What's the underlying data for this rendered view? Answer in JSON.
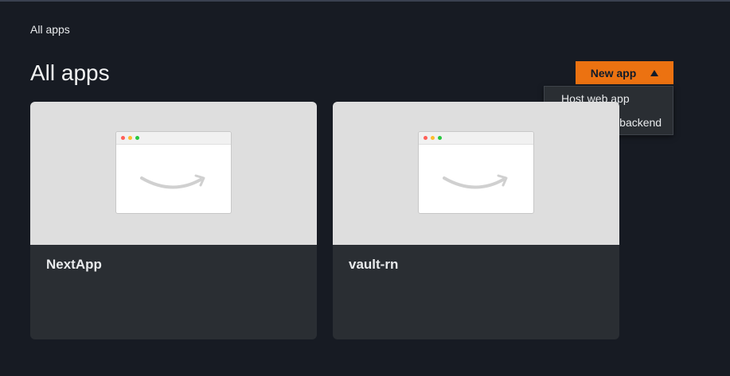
{
  "breadcrumb": "All apps",
  "page_title": "All apps",
  "new_app_button": {
    "label": "New app",
    "icon": "caret-up-icon"
  },
  "dropdown": {
    "items": [
      {
        "label": "Host web app"
      },
      {
        "label": "Create app backend"
      }
    ]
  },
  "apps": [
    {
      "name": "NextApp"
    },
    {
      "name": "vault-rn"
    }
  ],
  "colors": {
    "background": "#171b23",
    "accent": "#ec7211",
    "card": "#2a2e33",
    "preview": "#dedede"
  }
}
